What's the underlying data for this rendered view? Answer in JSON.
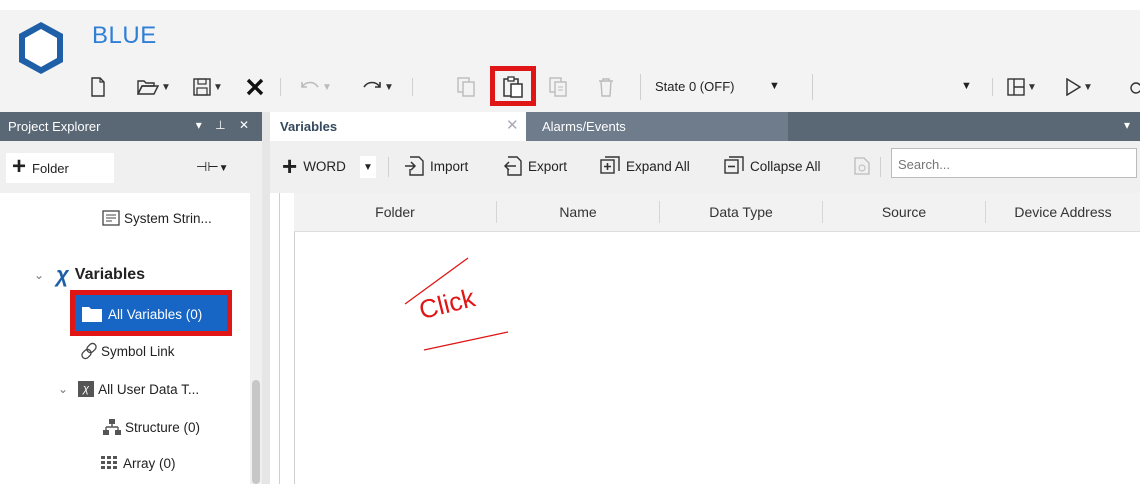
{
  "app": {
    "title": "BLUE"
  },
  "toolbar": {
    "state_label": "State 0 (OFF)",
    "secondary_select_value": ""
  },
  "project_explorer": {
    "title": "Project Explorer",
    "controls": "▾ ⊥ ✕",
    "folder_button": "Folder",
    "tree": {
      "system_strings": "System Strin...",
      "variables": "Variables",
      "all_variables": "All Variables (0)",
      "symbol_link": "Symbol Link",
      "all_user_data_types": "All User Data T...",
      "structure": "Structure (0)",
      "array": "Array (0)"
    }
  },
  "tabs": [
    {
      "label": "Variables",
      "active": true
    },
    {
      "label": "Alarms/Events",
      "active": false
    }
  ],
  "var_toolbar": {
    "add_type": "WORD",
    "import": "Import",
    "export": "Export",
    "expand_all": "Expand All",
    "collapse_all": "Collapse All",
    "search_placeholder": "Search..."
  },
  "grid": {
    "columns": [
      "Folder",
      "Name",
      "Data Type",
      "Source",
      "Device Address"
    ],
    "rows": []
  },
  "annotation": {
    "text": "Click"
  },
  "colors": {
    "accent": "#2f7fd6",
    "panel_header": "#5a6775",
    "highlight": "#e01515",
    "selection": "#1766c6"
  }
}
